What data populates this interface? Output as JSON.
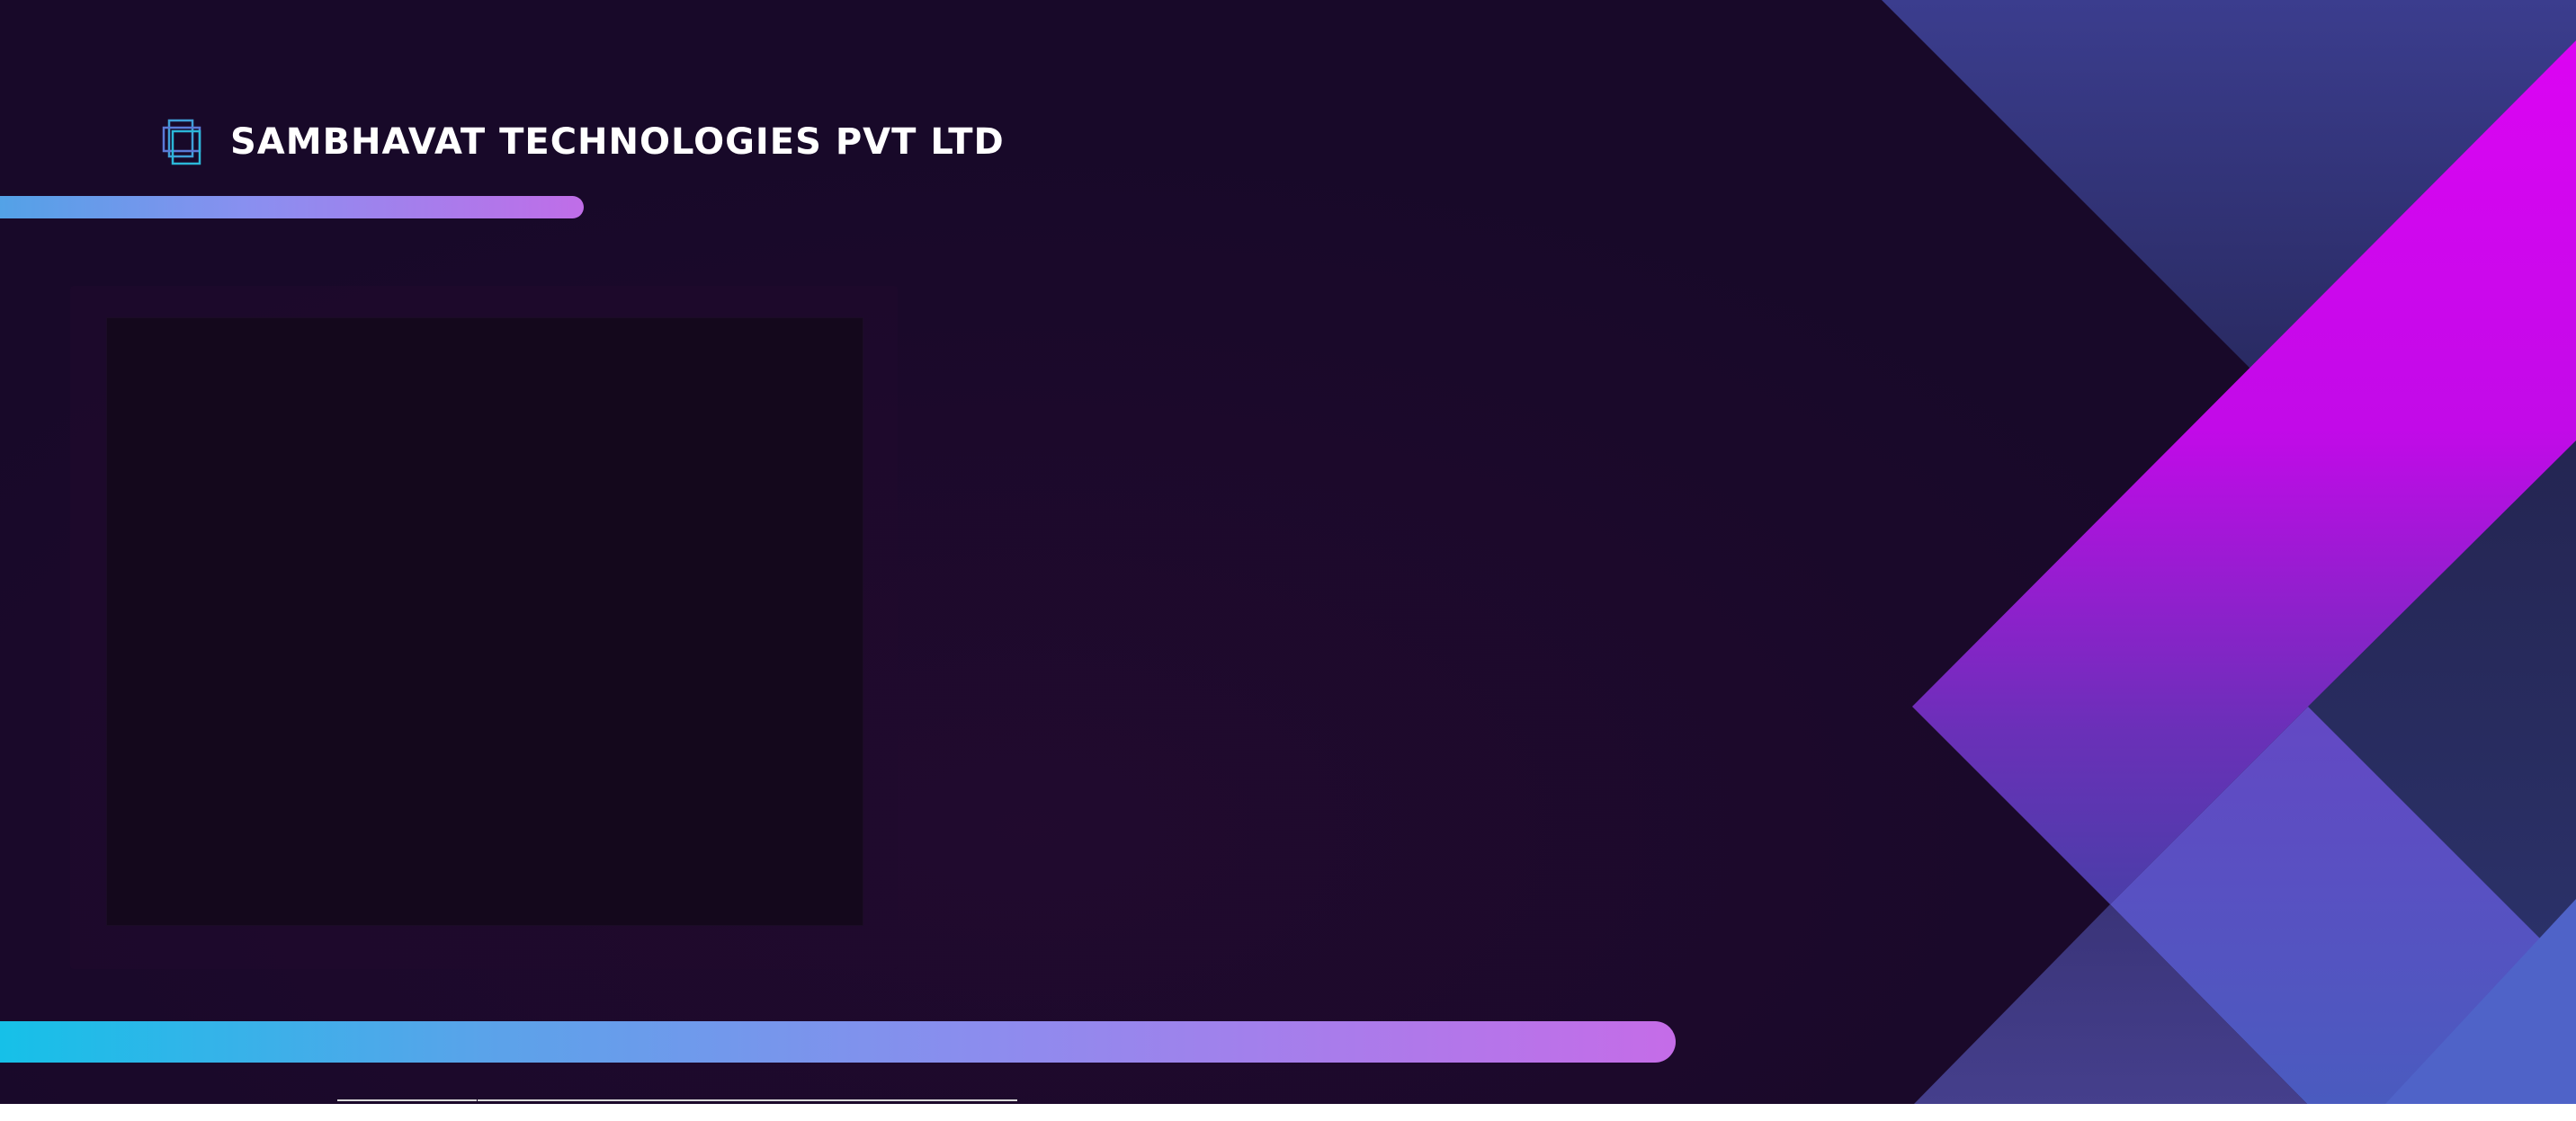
{
  "brand": {
    "name": "SAMBHAVAT TECHNOLOGIES PVT LTD",
    "logo_icon": "stacked-squares-logo-icon"
  },
  "colors": {
    "background": "#180929",
    "magenta_accent": "#dd06f2",
    "blue_accent": "#4f63c8",
    "bar_gradient_start": "#12c2e8",
    "bar_gradient_end": "#c56ce8",
    "frame_fill": "#14081c"
  }
}
